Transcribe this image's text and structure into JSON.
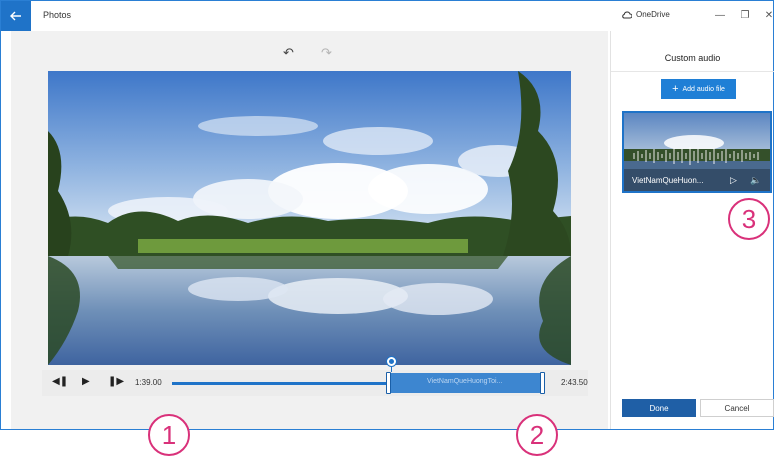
{
  "titlebar": {
    "app_title": "Photos",
    "onedrive_label": "OneDrive",
    "controls": {
      "minimize": "—",
      "maximize": "❐",
      "close": "✕"
    }
  },
  "editor": {
    "undo_icon": "↶",
    "redo_icon": "↷",
    "video_description": "",
    "player": {
      "start_time": "1:39.00",
      "end_time": "2:43.50",
      "audio_clip_label": "VietNamQueHuongToi...",
      "progress_fraction": 0.0
    }
  },
  "panel": {
    "title": "Custom audio",
    "add_button": "Add audio file",
    "audio_card": {
      "name": "VietNamQueHuon..."
    },
    "done_label": "Done",
    "cancel_label": "Cancel"
  },
  "callouts": [
    "1",
    "2",
    "3"
  ],
  "colors": {
    "accent": "#1f73c8",
    "callout": "#d9317a",
    "done": "#1f5fa6"
  },
  "icons": [
    "back-arrow-icon",
    "cloud-icon",
    "minimize-icon",
    "maximize-icon",
    "close-icon",
    "undo-icon",
    "redo-icon",
    "skip-back-icon",
    "play-icon",
    "skip-forward-icon",
    "plus-icon",
    "play-icon",
    "volume-icon"
  ]
}
